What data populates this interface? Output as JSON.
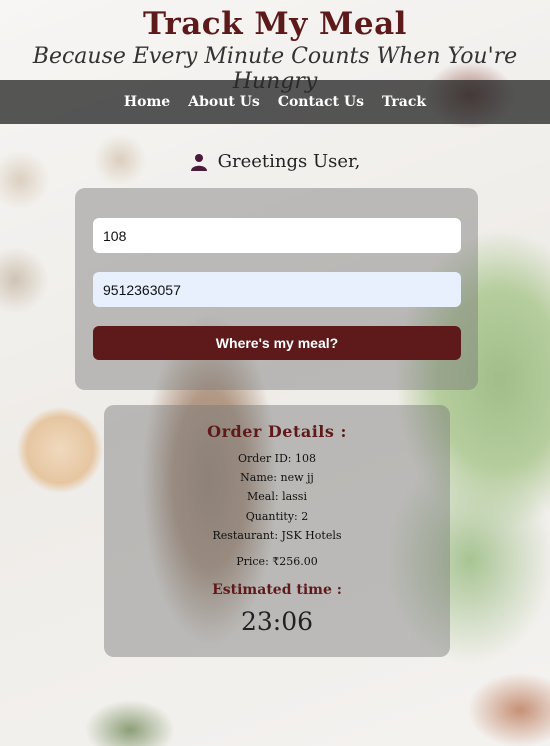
{
  "header": {
    "title": "Track My Meal",
    "tagline": "Because Every Minute Counts When You're Hungry"
  },
  "nav": {
    "home": "Home",
    "about": "About Us",
    "contact": "Contact Us",
    "track": "Track"
  },
  "greeting": {
    "icon": "user-icon",
    "text": "Greetings User,"
  },
  "form": {
    "order_id_value": "108",
    "phone_value": "9512363057",
    "submit_label": "Where's my meal?"
  },
  "order_details": {
    "heading": "Order Details :",
    "order_id": "Order ID: 108",
    "name": "Name: new jj",
    "meal": "Meal: lassi",
    "quantity": "Quantity: 2",
    "restaurant": "Restaurant: JSK Hotels",
    "price": "Price: ₹256.00",
    "eta_heading": "Estimated time :",
    "eta_value": "23:06"
  },
  "colors": {
    "accent": "#5e1a1a",
    "navbar": "#282828"
  }
}
